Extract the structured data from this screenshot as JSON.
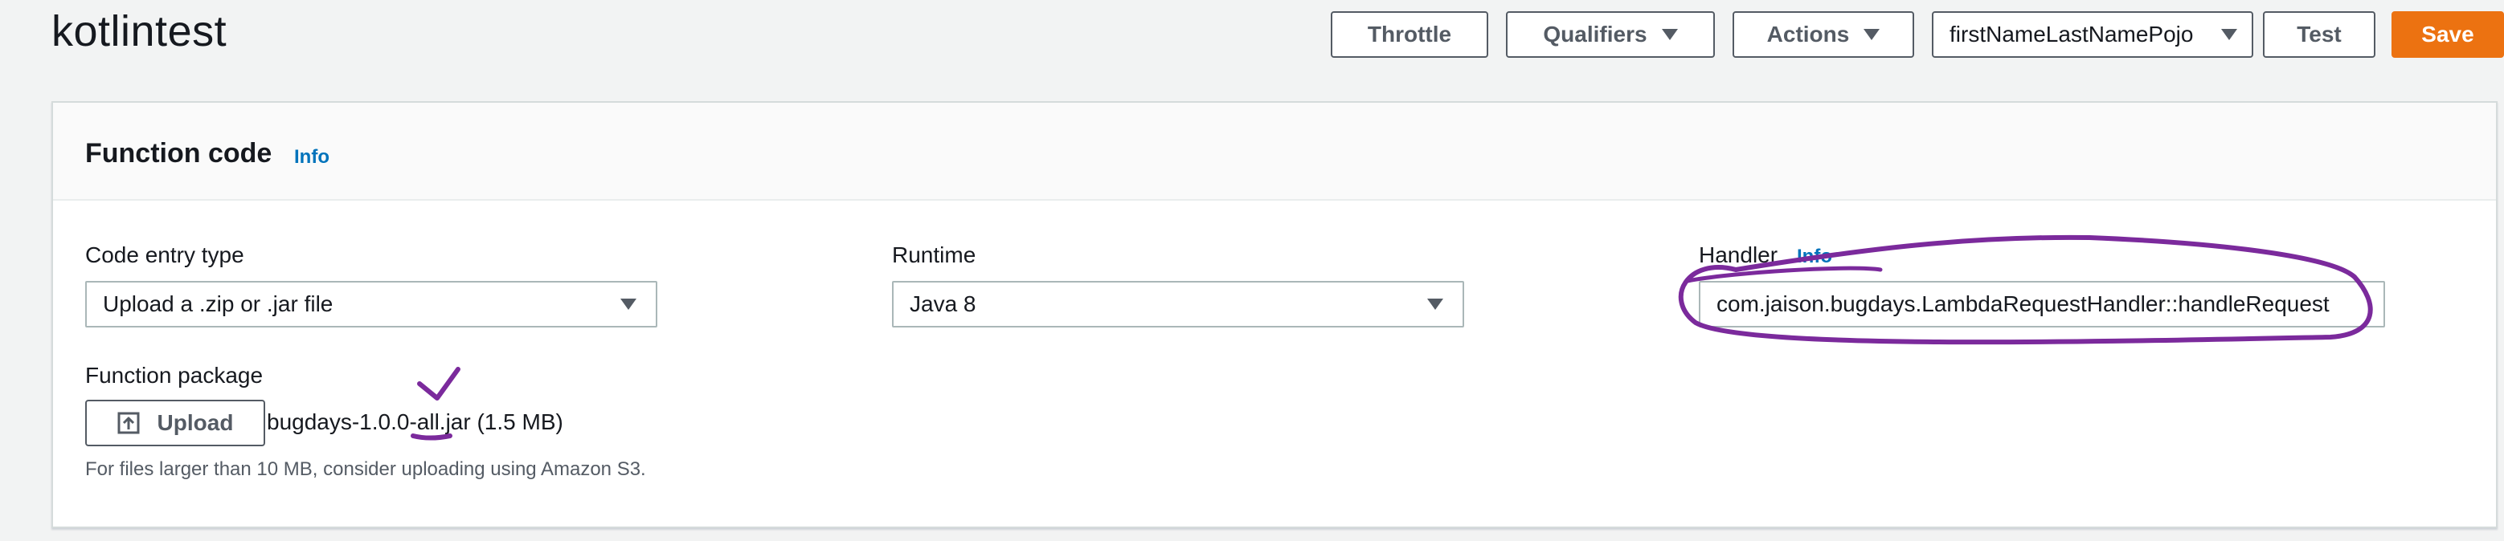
{
  "header": {
    "title": "kotlintest",
    "buttons": {
      "throttle": "Throttle",
      "qualifiers": "Qualifiers",
      "actions": "Actions",
      "test_event": "firstNameLastNamePojo",
      "test": "Test",
      "save": "Save"
    }
  },
  "function_code": {
    "title": "Function code",
    "info": "Info",
    "code_entry_type": {
      "label": "Code entry type",
      "value": "Upload a .zip or .jar file"
    },
    "runtime": {
      "label": "Runtime",
      "value": "Java 8"
    },
    "handler": {
      "label": "Handler",
      "info": "Info",
      "value": "com.jaison.bugdays.LambdaRequestHandler::handleRequest"
    },
    "function_package": {
      "label": "Function package",
      "upload_label": "Upload",
      "file": "bugdays-1.0.0-all.jar (1.5 MB)",
      "hint": "For files larger than 10 MB, consider uploading using Amazon S3."
    }
  },
  "colors": {
    "save_button": "#ec7211",
    "info_link": "#0073bb",
    "annotation": "#7b2a9c"
  }
}
